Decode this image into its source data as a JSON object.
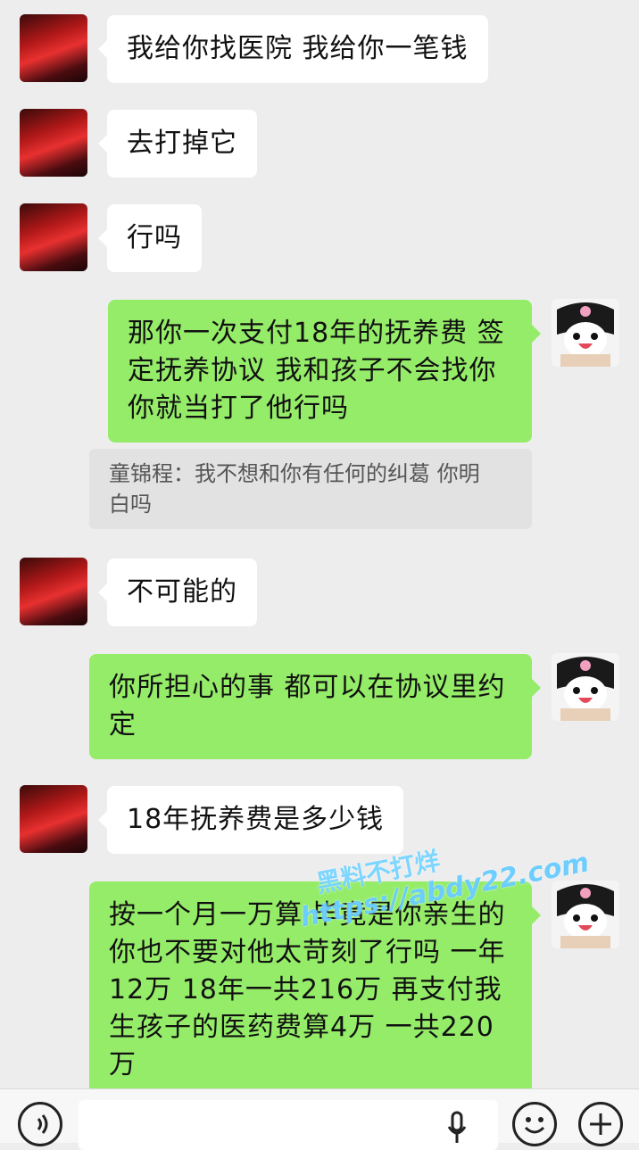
{
  "messages": [
    {
      "side": "in",
      "text": "我给你找医院 我给你一笔钱"
    },
    {
      "side": "in",
      "text": "去打掉它"
    },
    {
      "side": "in",
      "text": "行吗"
    },
    {
      "side": "out",
      "lines": [
        "那你一次支付18年的抚养费 签",
        "定抚养协议 我和孩子不会找你",
        "你就当打了他行吗"
      ]
    },
    {
      "side": "in",
      "text": "不可能的"
    },
    {
      "side": "out",
      "lines": [
        "你所担心的事 都可以在协议里约",
        "定"
      ]
    },
    {
      "side": "in",
      "text": "18年抚养费是多少钱"
    },
    {
      "side": "out",
      "lines": [
        "按一个月一万算 毕竟是你亲生的",
        "你也不要对他太苛刻了行吗 一年",
        "12万 18年一共216万 再支付我",
        "生孩子的医药费算4万 一共220",
        "万"
      ]
    }
  ],
  "quote": {
    "lines": [
      "童锦程：我不想和你有任何的纠葛 你明",
      "白吗"
    ]
  },
  "watermark": {
    "line1": "黑料不打烊",
    "line2": "https://abdy22.com"
  },
  "input_bar": {
    "voice_icon": "voice-icon",
    "mic_icon": "mic-icon",
    "emoji_icon": "emoji-icon",
    "plus_icon": "plus-icon"
  }
}
